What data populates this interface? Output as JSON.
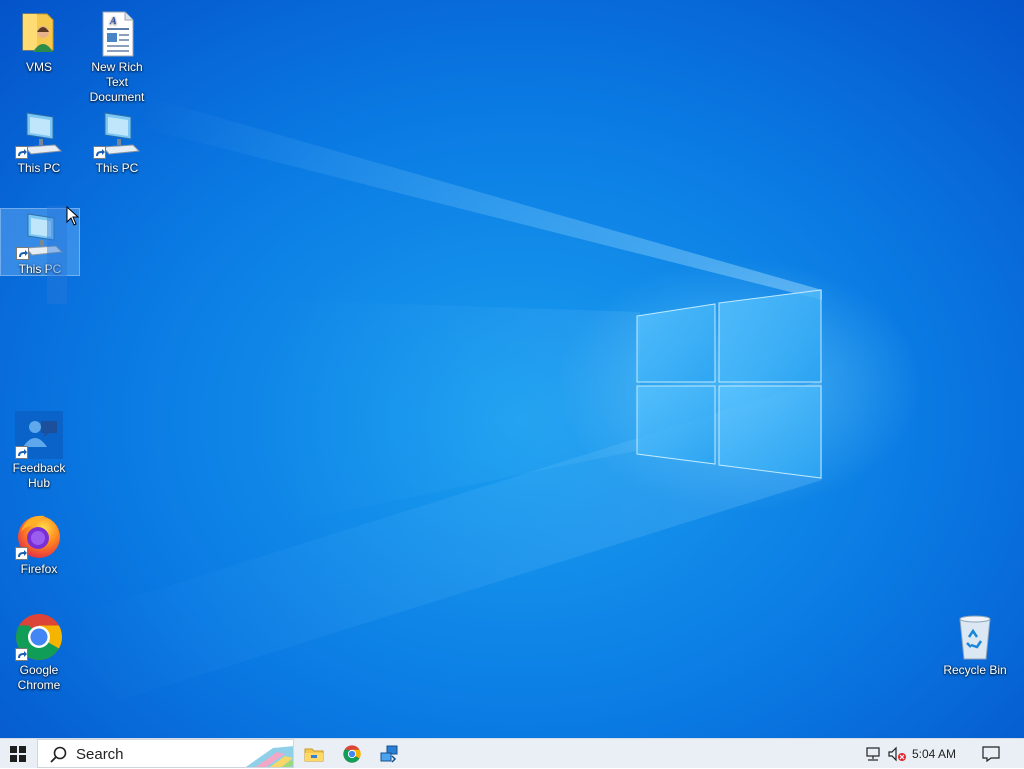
{
  "desktop": {
    "icons": [
      {
        "id": "vms",
        "label": "VMS"
      },
      {
        "id": "rtf",
        "label": "New Rich Text Document"
      },
      {
        "id": "thispc1",
        "label": "This PC"
      },
      {
        "id": "thispc2",
        "label": "This PC"
      },
      {
        "id": "thispc3",
        "label": "This PC"
      },
      {
        "id": "feedback",
        "label": "Feedback Hub"
      },
      {
        "id": "firefox",
        "label": "Firefox"
      },
      {
        "id": "chrome",
        "label": "Google Chrome"
      },
      {
        "id": "recycle",
        "label": "Recycle Bin"
      }
    ]
  },
  "taskbar": {
    "search_placeholder": "Search",
    "pinned": [
      "file-explorer-icon",
      "chrome-icon",
      "remote-desktop-icon"
    ],
    "clock": "5:04 AM"
  },
  "colors": {
    "desktop_accent": "#0a7ae3",
    "taskbar_bg": "#e9eff5"
  }
}
